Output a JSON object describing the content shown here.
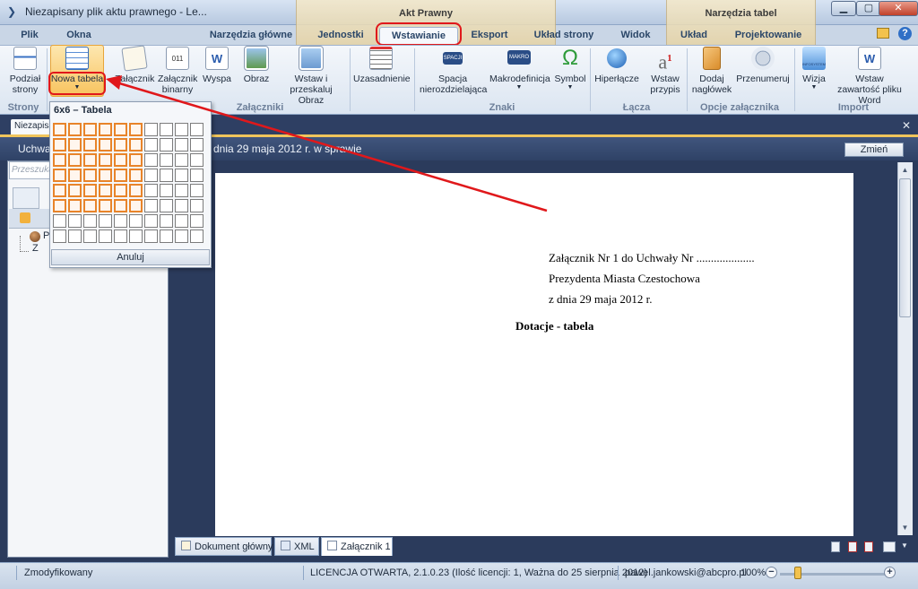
{
  "window": {
    "title": "Niezapisany plik aktu prawnego - Le...",
    "minimize": "▁",
    "maximize": "▢",
    "close": "✕"
  },
  "contextual_groups": {
    "akt": "Akt Prawny",
    "tabel": "Narzędzia tabel"
  },
  "tabs": [
    "Plik",
    "Okna",
    "Narzędzia główne",
    "Jednostki",
    "Wstawianie",
    "Eksport",
    "Układ strony",
    "Widok",
    "Układ",
    "Projektowanie"
  ],
  "active_tab": "Wstawianie",
  "ribbon": {
    "buttons": {
      "podzial": "Podział strony",
      "nowa_tabela": "Nowa tabela",
      "zalacznik": "Załącznik",
      "zalacznik_binarny": "Załącznik binarny",
      "wyspa": "Wyspa",
      "obraz": "Obraz",
      "wstaw_obraz": "Wstaw i przeskaluj Obraz",
      "uzasadnienie": "Uzasadnienie",
      "spacja": "Spacja nierozdzielająca",
      "makrodefinicja": "Makrodefinicja",
      "symbol": "Symbol",
      "hiperlacze": "Hiperłącze",
      "wstaw_przypis": "Wstaw przypis",
      "dodaj_naglowek": "Dodaj nagłówek",
      "przenumeruj": "Przenumeruj",
      "wizja": "Wizja",
      "wstaw_zawartosc": "Wstaw zawartość pliku Word"
    },
    "groups": {
      "strony": "Strony",
      "zalaczniki": "Załączniki",
      "znaki": "Znaki",
      "lacza": "Łącza",
      "opcje": "Opcje załącznika",
      "import": "Import"
    },
    "icon_labels": {
      "spacja": "SPACJI",
      "makro": "MAKRO",
      "symbol": "Ω",
      "przypis": "a",
      "przypis_num": "1",
      "zal_bin": "011",
      "word": "W",
      "wizja": "INFOSYSTEM"
    }
  },
  "document_tab": "Niezapisany",
  "header": {
    "title_left": "Uchwa",
    "title_right": "dnia 29 maja 2012 r. w sprawie",
    "change_button": "Zmień"
  },
  "left_panel": {
    "search_placeholder": "Przeszuka",
    "tree_item_1": "P",
    "tree_item_2": "Z"
  },
  "table_popup": {
    "title": "6x6 – Tabela",
    "cancel": "Anuluj",
    "selected_rows": 6,
    "selected_cols": 6,
    "total_rows": 8,
    "total_cols": 10
  },
  "document": {
    "line1": "Załącznik Nr 1 do Uchwały Nr ....................",
    "line2": "Prezydenta Miasta Czestochowa",
    "line3": "z dnia 29 maja 2012 r.",
    "heading": "Dotacje - tabela"
  },
  "bottom_tabs": [
    "Dokument główny",
    "XML",
    "Załącznik 1"
  ],
  "status": {
    "state": "Zmodyfikowany",
    "license": "LICENCJA OTWARTA, 2.1.0.23 (Ilość licencji: 1, Ważna do 25 sierpnia 2012)",
    "user": "pawel.jankowski@abcpro.pl",
    "zoom": "100%"
  },
  "colors": {
    "annotation": "#e0181b",
    "selection": "#e8842a"
  }
}
